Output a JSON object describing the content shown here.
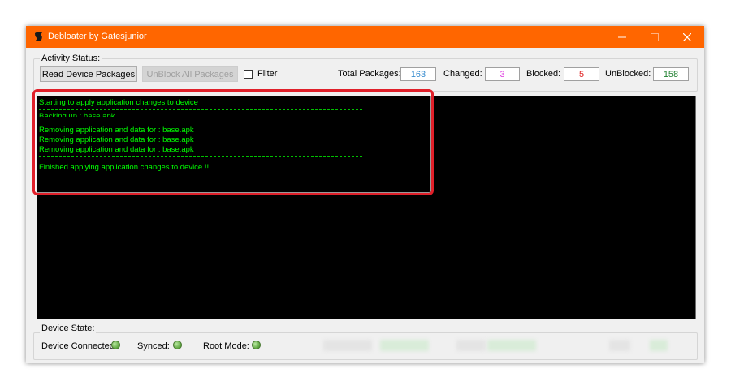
{
  "window": {
    "title": "Debloater by Gatesjunior",
    "controls": [
      "minimize-icon",
      "maximize-icon",
      "close-icon"
    ]
  },
  "activity": {
    "group_label": "Activity Status:",
    "read_button": "Read Device Packages",
    "unblock_button": "UnBlock All Packages",
    "filter_label": "Filter",
    "filter_checked": false,
    "stats": [
      {
        "label": "Total Packages:",
        "value": "163",
        "color": "#3a8dcf"
      },
      {
        "label": "Changed:",
        "value": "3",
        "color": "#e040e0"
      },
      {
        "label": "Blocked:",
        "value": "5",
        "color": "#e02020"
      },
      {
        "label": "UnBlocked:",
        "value": "158",
        "color": "#208030"
      }
    ]
  },
  "console": {
    "lines": [
      "Starting to apply application changes to device",
      "Backing up : base.apk",
      "Removing application and data for : base.apk",
      "Removing application and data for : base.apk",
      "Removing application and data for : base.apk",
      "Finished applying application changes to device !!"
    ],
    "text_color": "#00ff00"
  },
  "device": {
    "group_label": "Device State:",
    "connected_label": "Device Connected:",
    "synced_label": "Synced:",
    "root_label": "Root Mode:",
    "led_color": "#5ba33c"
  },
  "colors": {
    "titlebar": "#ff6600",
    "highlight": "#e0202a"
  }
}
